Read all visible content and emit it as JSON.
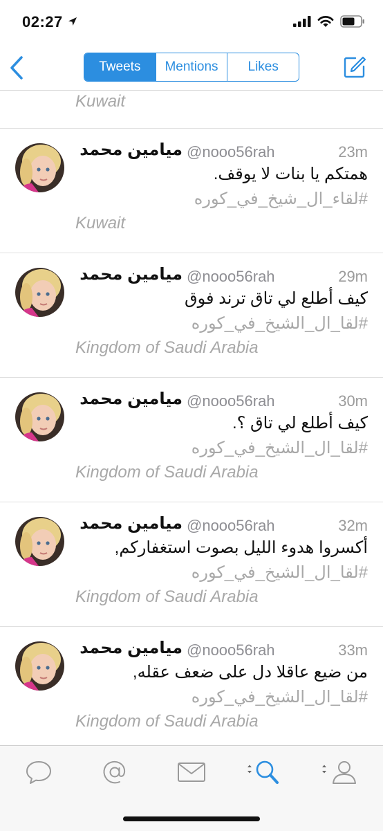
{
  "status_bar": {
    "time": "02:27",
    "icons": [
      "location-arrow-icon",
      "signal-icon",
      "wifi-icon",
      "battery-icon"
    ]
  },
  "nav": {
    "back_icon": "chevron-left-icon",
    "tabs": [
      {
        "label": "Tweets",
        "active": true
      },
      {
        "label": "Mentions",
        "active": false
      },
      {
        "label": "Likes",
        "active": false
      }
    ],
    "compose_icon": "compose-icon"
  },
  "feed": {
    "partial_location": "Kuwait",
    "tweets": [
      {
        "name": "ميامين محمد",
        "handle": "@nooo56rah",
        "time": "23m",
        "text": "همتكم يا بنات لا يوقف.",
        "hashtag": "#لقاء_ال_شيخ_في_كوره",
        "location": "Kuwait"
      },
      {
        "name": "ميامين محمد",
        "handle": "@nooo56rah",
        "time": "29m",
        "text": "كيف أطلع لي تاق ترند فوق",
        "hashtag": "#لقا_ال_الشيخ_في_كوره",
        "location": "Kingdom of Saudi Arabia"
      },
      {
        "name": "ميامين محمد",
        "handle": "@nooo56rah",
        "time": "30m",
        "text": "كيف أطلع لي تاق ؟.",
        "hashtag": "#لقا_ال_الشيخ_في_كوره",
        "location": "Kingdom of Saudi Arabia"
      },
      {
        "name": "ميامين محمد",
        "handle": "@nooo56rah",
        "time": "32m",
        "text": "أكسروا هدوء الليل بصوت استغفاركم,",
        "hashtag": "#لقا_ال_الشيخ_في_كوره",
        "location": "Kingdom of Saudi Arabia"
      },
      {
        "name": "ميامين محمد",
        "handle": "@nooo56rah",
        "time": "33m",
        "text": "من ضيع عاقلا دل على ضعف عقله,",
        "hashtag": "#لقا_ال_الشيخ_في_كوره",
        "location": "Kingdom of Saudi Arabia"
      }
    ]
  },
  "tabbar": {
    "icons": [
      "speech-bubble-icon",
      "at-sign-icon",
      "envelope-icon",
      "search-icon",
      "profile-icon"
    ],
    "active_color": "#2c8ee0",
    "inactive_color": "#9a9a9a"
  },
  "colors": {
    "accent": "#2c8ee0",
    "muted": "#a8a8a8"
  }
}
